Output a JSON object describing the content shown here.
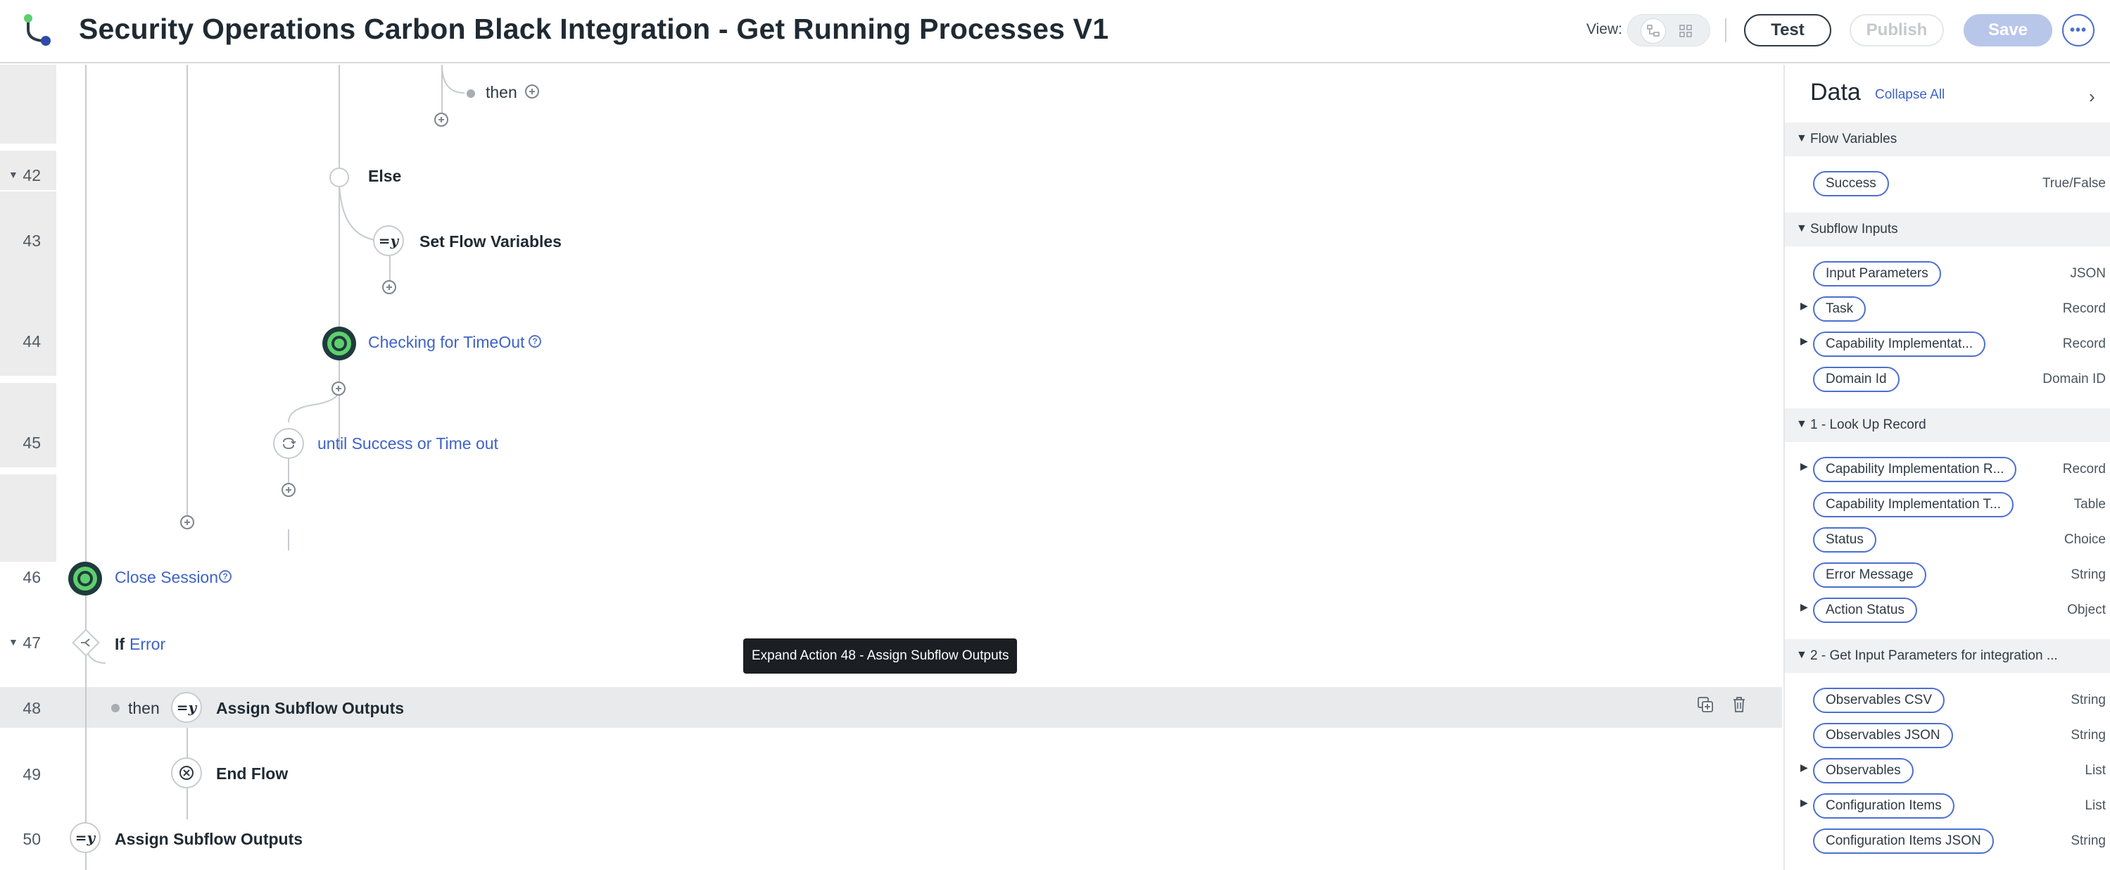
{
  "header": {
    "title": "Security Operations Carbon Black Integration - Get Running Processes V1",
    "view_label": "View:",
    "test_label": "Test",
    "publish_label": "Publish",
    "save_label": "Save",
    "more_label": "•••"
  },
  "flow": {
    "then_top": "then",
    "else_label": "Else",
    "set_flow_variables": "Set Flow Variables",
    "checking_timeout": "Checking for TimeOut",
    "until_label": "until Success or Time out",
    "close_session": "Close Session",
    "if_label": "If",
    "if_condition": "Error",
    "then_48": "then",
    "assign_48": "Assign Subflow Outputs",
    "end_flow": "End Flow",
    "assign_50": "Assign Subflow Outputs",
    "assign_icon": "=y",
    "help_glyph": "?",
    "tooltip": "Expand Action 48 - Assign Subflow Outputs",
    "row_numbers": {
      "r42": "42",
      "r43": "43",
      "r44": "44",
      "r45": "45",
      "r46": "46",
      "r47": "47",
      "r48": "48",
      "r49": "49",
      "r50": "50"
    }
  },
  "panel": {
    "title": "Data",
    "collapse_all": "Collapse All",
    "sections": {
      "flow_variables": {
        "title": "Flow Variables",
        "items": [
          {
            "label": "Success",
            "type": "True/False"
          }
        ]
      },
      "subflow_inputs": {
        "title": "Subflow Inputs",
        "items": [
          {
            "label": "Input Parameters",
            "type": "JSON"
          },
          {
            "label": "Task",
            "type": "Record"
          },
          {
            "label": "Capability Implementat...",
            "type": "Record"
          },
          {
            "label": "Domain Id",
            "type": "Domain ID"
          }
        ]
      },
      "lookup_record": {
        "title": "1 - Look Up Record",
        "items": [
          {
            "label": "Capability Implementation R...",
            "type": "Record"
          },
          {
            "label": "Capability Implementation T...",
            "type": "Table"
          },
          {
            "label": "Status",
            "type": "Choice"
          },
          {
            "label": "Error Message",
            "type": "String"
          },
          {
            "label": "Action Status",
            "type": "Object"
          }
        ]
      },
      "get_input_params": {
        "title": "2 - Get Input Parameters for integration ...",
        "items": [
          {
            "label": "Observables CSV",
            "type": "String"
          },
          {
            "label": "Observables JSON",
            "type": "String"
          },
          {
            "label": "Observables",
            "type": "List"
          },
          {
            "label": "Configuration Items",
            "type": "List"
          },
          {
            "label": "Configuration Items JSON",
            "type": "String"
          }
        ]
      }
    }
  },
  "icons": {
    "logo": "flow-designer-logo-icon",
    "flow_view": "flow-view-icon",
    "grid_view": "grid-view-icon",
    "copy": "duplicate-icon",
    "delete": "trash-icon",
    "loop": "loop-icon",
    "if": "branch-icon",
    "end": "end-flow-icon"
  },
  "colors": {
    "accent": "#3e63c6",
    "action_green": "#5ecf6e",
    "save_disabled": "#b8c6ea",
    "highlight_row": "#e8eaec"
  }
}
